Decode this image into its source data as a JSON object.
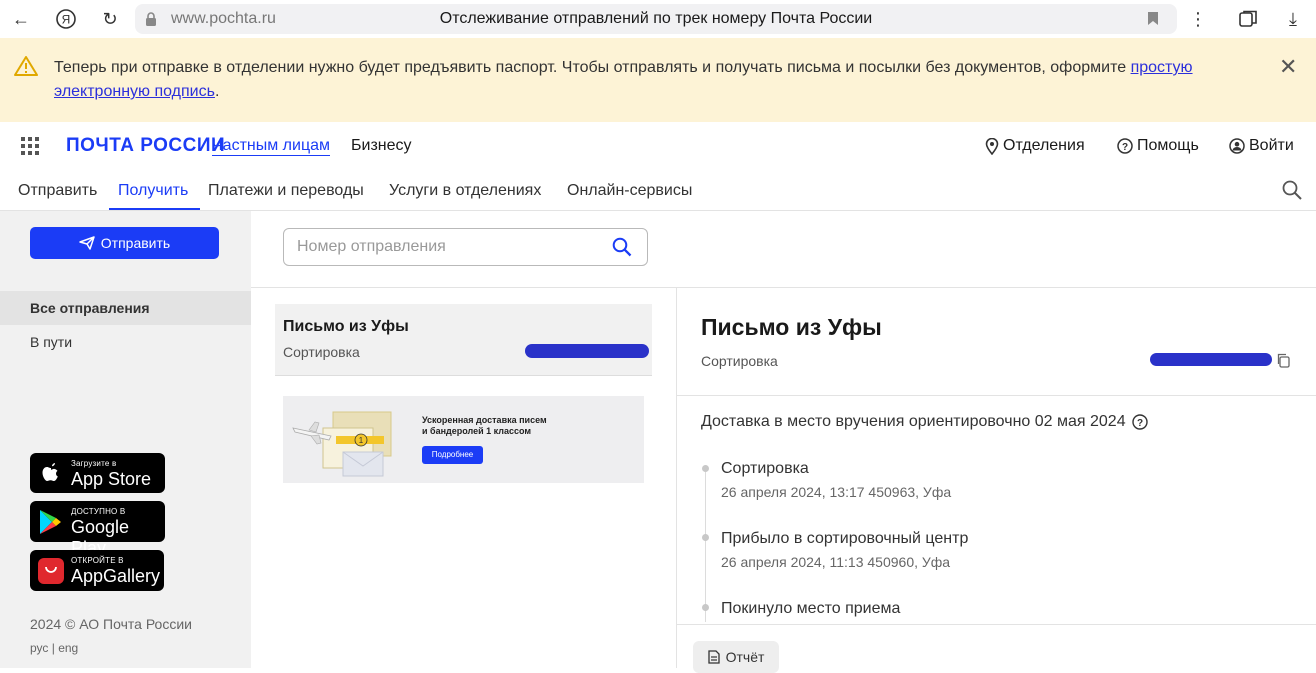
{
  "browser": {
    "url": "www.pochta.ru",
    "title": "Отслеживание отправлений по трек номеру Почта России"
  },
  "notice": {
    "text": "Теперь при отправке в отделении нужно будет предъявить паспорт. Чтобы отправлять и получать письма и посылки без документов, оформите ",
    "link": "простую электронную подпись",
    "tail": "."
  },
  "header": {
    "logo": "ПОЧТА РОССИИ",
    "segments": [
      "Частным лицам",
      "Бизнесу"
    ],
    "offices": "Отделения",
    "help": "Помощь",
    "login": "Войти"
  },
  "nav": [
    "Отправить",
    "Получить",
    "Платежи и переводы",
    "Услуги в отделениях",
    "Онлайн-сервисы"
  ],
  "sidebar": {
    "send_button": "Отправить",
    "items": [
      "Все отправления",
      "В пути"
    ],
    "stores": [
      {
        "small": "Загрузите в",
        "big": "App Store"
      },
      {
        "small": "ДОСТУПНО В",
        "big": "Google Play"
      },
      {
        "small": "ОТКРОЙТЕ В",
        "big": "AppGallery"
      }
    ],
    "copyright": "2024 © АО Почта России",
    "lang": "рус | eng"
  },
  "search": {
    "placeholder": "Номер отправления"
  },
  "card": {
    "title": "Письмо из Уфы",
    "status": "Сортировка"
  },
  "banner": {
    "text_line1": "Ускоренная доставка писем",
    "text_line2": "и бандеролей 1 классом",
    "button": "Подробнее"
  },
  "detail": {
    "title": "Письмо из Уфы",
    "status": "Сортировка",
    "eta": "Доставка в место вручения ориентировочно 02 мая 2024",
    "events": [
      {
        "title": "Сортировка",
        "sub": "26 апреля 2024, 13:17 450963, Уфа"
      },
      {
        "title": "Прибыло в сортировочный центр",
        "sub": "26 апреля 2024, 11:13 450960, Уфа"
      },
      {
        "title": "Покинуло место приема",
        "sub": ""
      }
    ],
    "report_button": "Отчёт"
  },
  "colors": {
    "accent": "#1b3cf6",
    "notice_bg": "#fdf3d6",
    "sidebar_bg": "#f1f1f1"
  }
}
